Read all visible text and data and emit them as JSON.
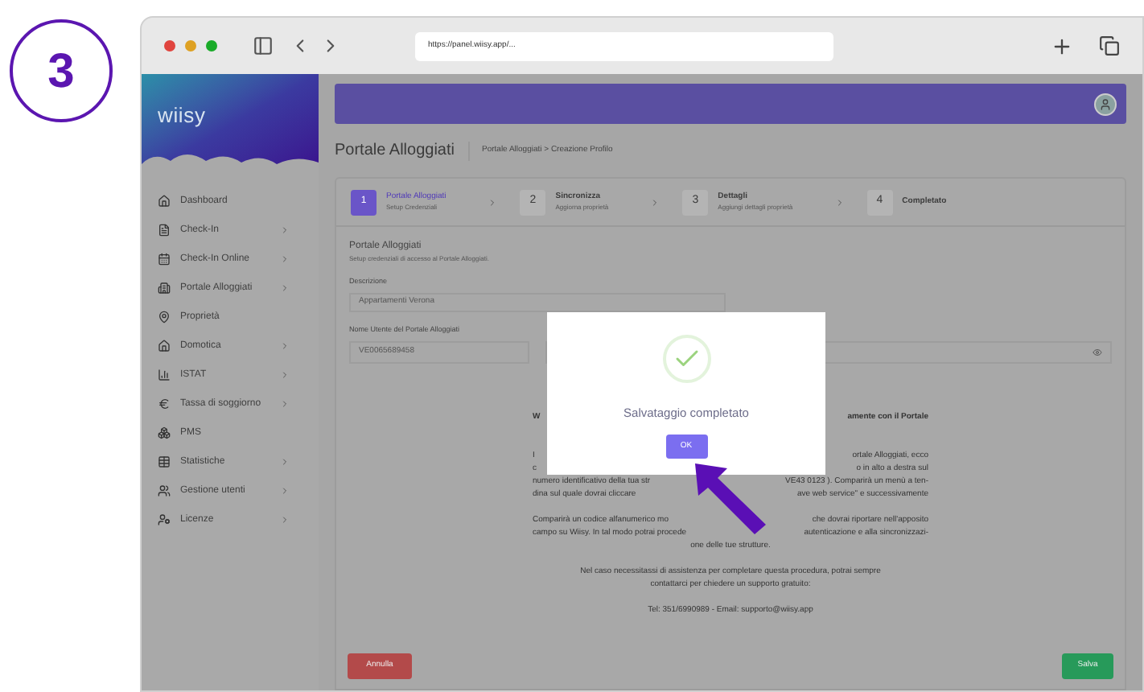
{
  "step_badge": "3",
  "browser": {
    "url": "https://panel.wiisy.app/..."
  },
  "logo": {
    "text": "wiisy"
  },
  "sidebar": {
    "items": [
      {
        "label": "Dashboard",
        "kind": "home",
        "has_submenu": false
      },
      {
        "label": "Check-In",
        "kind": "doc",
        "has_submenu": true
      },
      {
        "label": "Check-In Online",
        "kind": "calendar",
        "has_submenu": true
      },
      {
        "label": "Portale Alloggiati",
        "kind": "building",
        "has_submenu": true
      },
      {
        "label": "Proprietà",
        "kind": "pin",
        "has_submenu": false
      },
      {
        "label": "Domotica",
        "kind": "house",
        "has_submenu": true
      },
      {
        "label": "ISTAT",
        "kind": "chart",
        "has_submenu": true
      },
      {
        "label": "Tassa di soggiorno",
        "kind": "euro",
        "has_submenu": true
      },
      {
        "label": "PMS",
        "kind": "pms",
        "has_submenu": false
      },
      {
        "label": "Statistiche",
        "kind": "table",
        "has_submenu": true
      },
      {
        "label": "Gestione utenti",
        "kind": "users",
        "has_submenu": true
      },
      {
        "label": "Licenze",
        "kind": "license",
        "has_submenu": true
      }
    ]
  },
  "page": {
    "title": "Portale Alloggiati",
    "breadcrumb": [
      "Portale Alloggiati",
      "Creazione Profilo"
    ],
    "breadcrumb_separator": ">"
  },
  "steps": [
    {
      "number": "1",
      "title": "Portale Alloggiati",
      "subtitle": "Setup Credenziali",
      "selected": true
    },
    {
      "number": "2",
      "title": "Sincronizza",
      "subtitle": "Aggiorna proprietà",
      "selected": false
    },
    {
      "number": "3",
      "title": "Dettagli",
      "subtitle": "Aggiungi dettagli proprietà",
      "selected": false
    },
    {
      "number": "4",
      "title": "Completato",
      "selected": false
    }
  ],
  "form": {
    "title": "Portale Alloggiati",
    "subtitle": "Setup credenziali di accesso al Portale Alloggiati.",
    "description": {
      "label": "Descrizione",
      "value": "Appartamenti Verona"
    },
    "username": {
      "label": "Nome Utente del Portale Alloggiati",
      "value": "VE0065689458"
    }
  },
  "info_lines": [
    {
      "parts": [
        "W",
        "amente con il Portale"
      ],
      "bold": true
    },
    {
      "parts": [
        "I",
        "ortale Alloggiati, ecco"
      ],
      "bold": false
    },
    {
      "parts": [
        "c",
        "o in alto a destra sul"
      ],
      "bold": false
    },
    {
      "parts": [
        "numero identificativo della tua str",
        "VE43 0123 ). Comparirà un menù a ten-"
      ],
      "bold": false
    },
    {
      "parts": [
        "dina sul quale dovrai cliccare",
        "ave web service\" e successivamente"
      ],
      "bold": false
    },
    {
      "parts": [
        "Comparirà un codice alfanumerico mo",
        "che dovrai riportare nell'apposito"
      ],
      "bold": false
    },
    {
      "parts": [
        "campo su Wiisy. In tal modo potrai procede",
        "autenticazione e alla sincronizzazi-"
      ],
      "bold": false
    },
    {
      "parts": [
        "one delle tue strutture."
      ],
      "bold": false
    },
    {
      "parts": [
        "Nel caso necessitassi di assistenza per completare questa procedura, potrai sempre"
      ],
      "bold": false
    },
    {
      "parts": [
        "contattarci per chiedere un supporto gratuito:"
      ],
      "bold": false
    },
    {
      "parts": [
        "Tel: 351/6990989 - Email: supporto@wiisy.app"
      ],
      "bold": false
    }
  ],
  "buttons": {
    "cancel": "Annulla",
    "save": "Salva"
  },
  "modal": {
    "message": "Salvataggio completato",
    "ok": "OK"
  }
}
